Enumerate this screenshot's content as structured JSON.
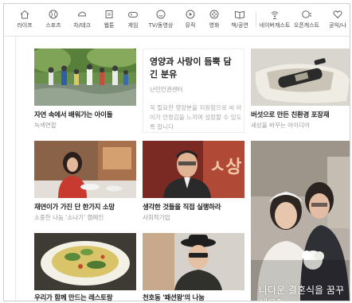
{
  "nav": {
    "items": [
      {
        "label": "라이프",
        "icon": "home-icon"
      },
      {
        "label": "스포츠",
        "icon": "ball-icon"
      },
      {
        "label": "차/테크",
        "icon": "car-icon"
      },
      {
        "label": "웹툰",
        "icon": "book-icon"
      },
      {
        "label": "게임",
        "icon": "gamepad-icon"
      },
      {
        "label": "TV/동영상",
        "icon": "smile-icon"
      },
      {
        "label": "뮤직",
        "icon": "play-icon"
      },
      {
        "label": "영화",
        "icon": "film-icon"
      },
      {
        "label": "책/공연",
        "icon": "open-book-icon"
      },
      {
        "label": "네이버캐스트",
        "icon": "broadcast-icon"
      },
      {
        "label": "오픈캐스트",
        "icon": "dots-icon"
      },
      {
        "label": "공익/나",
        "icon": "heart-icon"
      }
    ]
  },
  "cards": {
    "c1": {
      "title": "자연 속에서 배워가는 아이들",
      "sub": "녹색연합"
    },
    "c2": {
      "title": "영양과 사랑이 듬뿍 담긴 분유",
      "sub": "난민인권센터",
      "desc": "꼭 필요한 영양분을 지원함으로 써 아이가 안정감을 느끼며 성장할 수 있도록 합니다"
    },
    "c3": {
      "title": "버섯으로 만든 친환경 포장재",
      "sub": "세상을 바꾸는 아이디어"
    },
    "c4": {
      "title": "재연이가 가진 단 한가지 소망",
      "sub": "소중한 나눔 '소나기' 캠페인"
    },
    "c5": {
      "title": "생각한 것들을 직접 실행하라",
      "sub": "사회적기업"
    },
    "c6": {
      "caption": "나다운 결혼식을 꿈꾸세요?"
    },
    "c7": {
      "title": "우리가 함께 만드는 레스토랑"
    },
    "c8": {
      "title": "천호동 '패션왕'의 나눔"
    }
  }
}
